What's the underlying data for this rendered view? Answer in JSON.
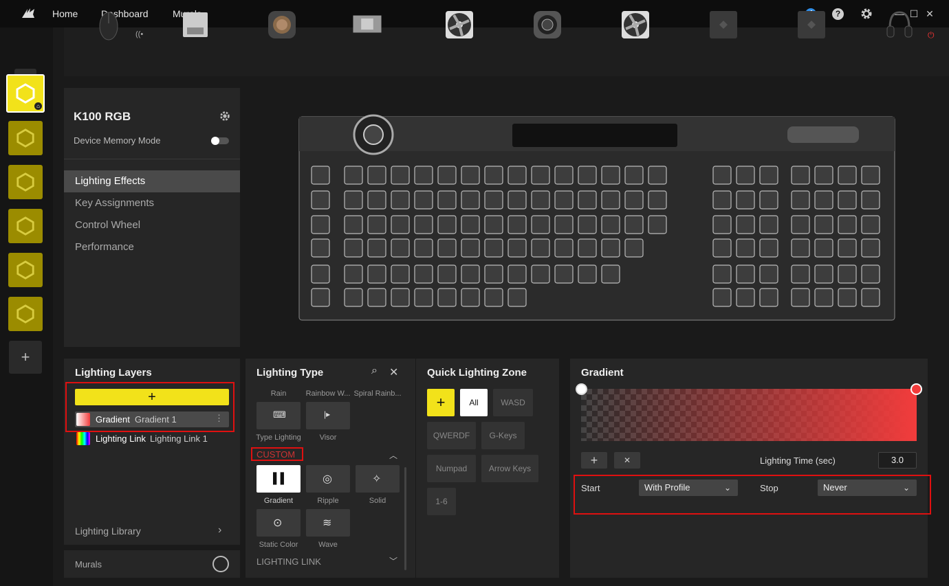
{
  "titlebar": {
    "nav": [
      "Home",
      "Dashboard",
      "Murals"
    ],
    "notification_count": "4",
    "help_label": "?"
  },
  "sidebar": {
    "profiles_count": 6,
    "add_label": "+"
  },
  "devices": [
    "mouse",
    "usb-receiver",
    "cooler-pump",
    "gpu-block",
    "fan",
    "pump-head",
    "fan",
    "hub",
    "hub",
    "headset"
  ],
  "device_panel": {
    "name": "K100 RGB",
    "memory_mode_label": "Device Memory Mode",
    "menu": [
      "Lighting Effects",
      "Key Assignments",
      "Control Wheel",
      "Performance"
    ],
    "selected_menu": "Lighting Effects"
  },
  "lighting_layers": {
    "title": "Lighting Layers",
    "add_label": "+",
    "layers": [
      {
        "type": "Gradient",
        "name": "Gradient 1"
      },
      {
        "type": "Lighting Link",
        "name": "Lighting Link 1"
      }
    ],
    "library_label": "Lighting Library",
    "murals_label": "Murals"
  },
  "lighting_type": {
    "title": "Lighting Type",
    "top_labels": [
      "Rain",
      "Rainbow W...",
      "Spiral Rainb..."
    ],
    "mid_labels": [
      "Type Lighting",
      "Visor"
    ],
    "custom_label": "CUSTOM",
    "custom_effects": [
      "Gradient",
      "Ripple",
      "Solid",
      "Static Color",
      "Wave"
    ],
    "lighting_link_label": "LIGHTING LINK"
  },
  "quick_zone": {
    "title": "Quick Lighting Zone",
    "add_label": "+",
    "zones": [
      "All",
      "WASD",
      "QWERDF",
      "G-Keys",
      "Numpad",
      "Arrow Keys",
      "1-6"
    ]
  },
  "gradient": {
    "title": "Gradient",
    "start_color": "#ffffff",
    "end_color": "#f23c3c",
    "add_label": "+",
    "remove_label": "✕",
    "time_label": "Lighting Time (sec)",
    "time_value": "3.0",
    "start_label": "Start",
    "start_value": "With Profile",
    "stop_label": "Stop",
    "stop_value": "Never"
  },
  "colors": {
    "accent": "#f2e21a",
    "highlight": "#e01010"
  }
}
